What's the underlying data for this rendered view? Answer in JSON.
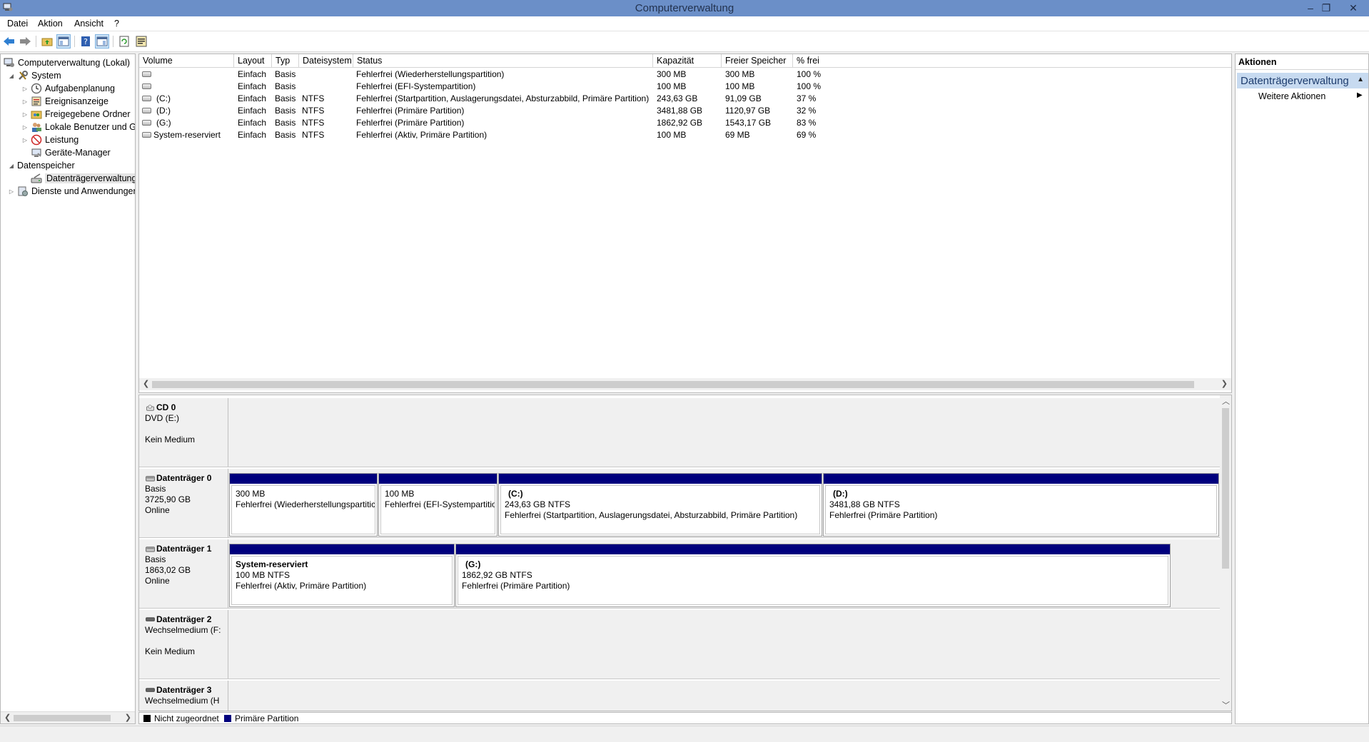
{
  "window": {
    "title": "Computerverwaltung",
    "minimize": "–",
    "restore": "❐",
    "close": "✕"
  },
  "menu": [
    "Datei",
    "Aktion",
    "Ansicht",
    "?"
  ],
  "tree": {
    "root": "Computerverwaltung (Lokal)",
    "system": "System",
    "aufgabenplanung": "Aufgabenplanung",
    "ereignisanzeige": "Ereignisanzeige",
    "freigegebene_ordner": "Freigegebene Ordner",
    "lokale_benutzer": "Lokale Benutzer und Gr",
    "leistung": "Leistung",
    "geraete_manager": "Geräte-Manager",
    "datenspeicher": "Datenspeicher",
    "datentraegerverwaltung": "Datenträgerverwaltung",
    "dienste": "Dienste und Anwendungen"
  },
  "volumes": {
    "columns": [
      "Volume",
      "Layout",
      "Typ",
      "Dateisystem",
      "Status",
      "Kapazität",
      "Freier Speicher",
      "% frei"
    ],
    "rows": [
      {
        "volume": "",
        "layout": "Einfach",
        "typ": "Basis",
        "fs": "",
        "status": "Fehlerfrei (Wiederherstellungspartition)",
        "kap": "300 MB",
        "frei": "300 MB",
        "pct": "100 %"
      },
      {
        "volume": "",
        "layout": "Einfach",
        "typ": "Basis",
        "fs": "",
        "status": "Fehlerfrei (EFI-Systempartition)",
        "kap": "100 MB",
        "frei": "100 MB",
        "pct": "100 %"
      },
      {
        "volume": "(C:)",
        "layout": "Einfach",
        "typ": "Basis",
        "fs": "NTFS",
        "status": "Fehlerfrei (Startpartition, Auslagerungsdatei, Absturzabbild, Primäre Partition)",
        "kap": "243,63 GB",
        "frei": "91,09 GB",
        "pct": "37 %"
      },
      {
        "volume": "(D:)",
        "layout": "Einfach",
        "typ": "Basis",
        "fs": "NTFS",
        "status": "Fehlerfrei (Primäre Partition)",
        "kap": "3481,88 GB",
        "frei": "1120,97 GB",
        "pct": "32 %"
      },
      {
        "volume": "(G:)",
        "layout": "Einfach",
        "typ": "Basis",
        "fs": "NTFS",
        "status": "Fehlerfrei (Primäre Partition)",
        "kap": "1862,92 GB",
        "frei": "1543,17 GB",
        "pct": "83 %"
      },
      {
        "volume": "System-reserviert",
        "layout": "Einfach",
        "typ": "Basis",
        "fs": "NTFS",
        "status": "Fehlerfrei (Aktiv, Primäre Partition)",
        "kap": "100 MB",
        "frei": "69 MB",
        "pct": "69 %"
      }
    ]
  },
  "disks": {
    "cd0": {
      "name": "CD 0",
      "l1": "DVD (E:)",
      "l2": "",
      "l3": "Kein Medium"
    },
    "d0": {
      "name": "Datenträger 0",
      "l1": "Basis",
      "l2": "3725,90 GB",
      "l3": "Online",
      "parts": [
        {
          "name": "",
          "size": "300 MB",
          "status": "Fehlerfrei (Wiederherstellungspartitic"
        },
        {
          "name": "",
          "size": "100 MB",
          "status": "Fehlerfrei (EFI-Systempartitio"
        },
        {
          "name": "(C:)",
          "size": "243,63 GB NTFS",
          "status": "Fehlerfrei (Startpartition, Auslagerungsdatei, Absturzabbild, Primäre Partition)"
        },
        {
          "name": "(D:)",
          "size": "3481,88 GB NTFS",
          "status": "Fehlerfrei (Primäre Partition)"
        }
      ]
    },
    "d1": {
      "name": "Datenträger 1",
      "l1": "Basis",
      "l2": "1863,02 GB",
      "l3": "Online",
      "parts": [
        {
          "name": "System-reserviert",
          "size": "100 MB NTFS",
          "status": "Fehlerfrei (Aktiv, Primäre Partition)"
        },
        {
          "name": "(G:)",
          "size": "1862,92 GB NTFS",
          "status": "Fehlerfrei (Primäre Partition)"
        }
      ]
    },
    "d2": {
      "name": "Datenträger 2",
      "l1": "Wechselmedium (F:",
      "l2": "",
      "l3": "Kein Medium"
    },
    "d3": {
      "name": "Datenträger 3",
      "l1": "Wechselmedium (H",
      "l2": "",
      "l3": ""
    }
  },
  "legend": {
    "unallocated": "Nicht zugeordnet",
    "primary": "Primäre Partition",
    "unallocated_color": "#000000",
    "primary_color": "#00007d"
  },
  "actions": {
    "header": "Aktionen",
    "section": "Datenträgerverwaltung",
    "more": "Weitere Aktionen"
  }
}
